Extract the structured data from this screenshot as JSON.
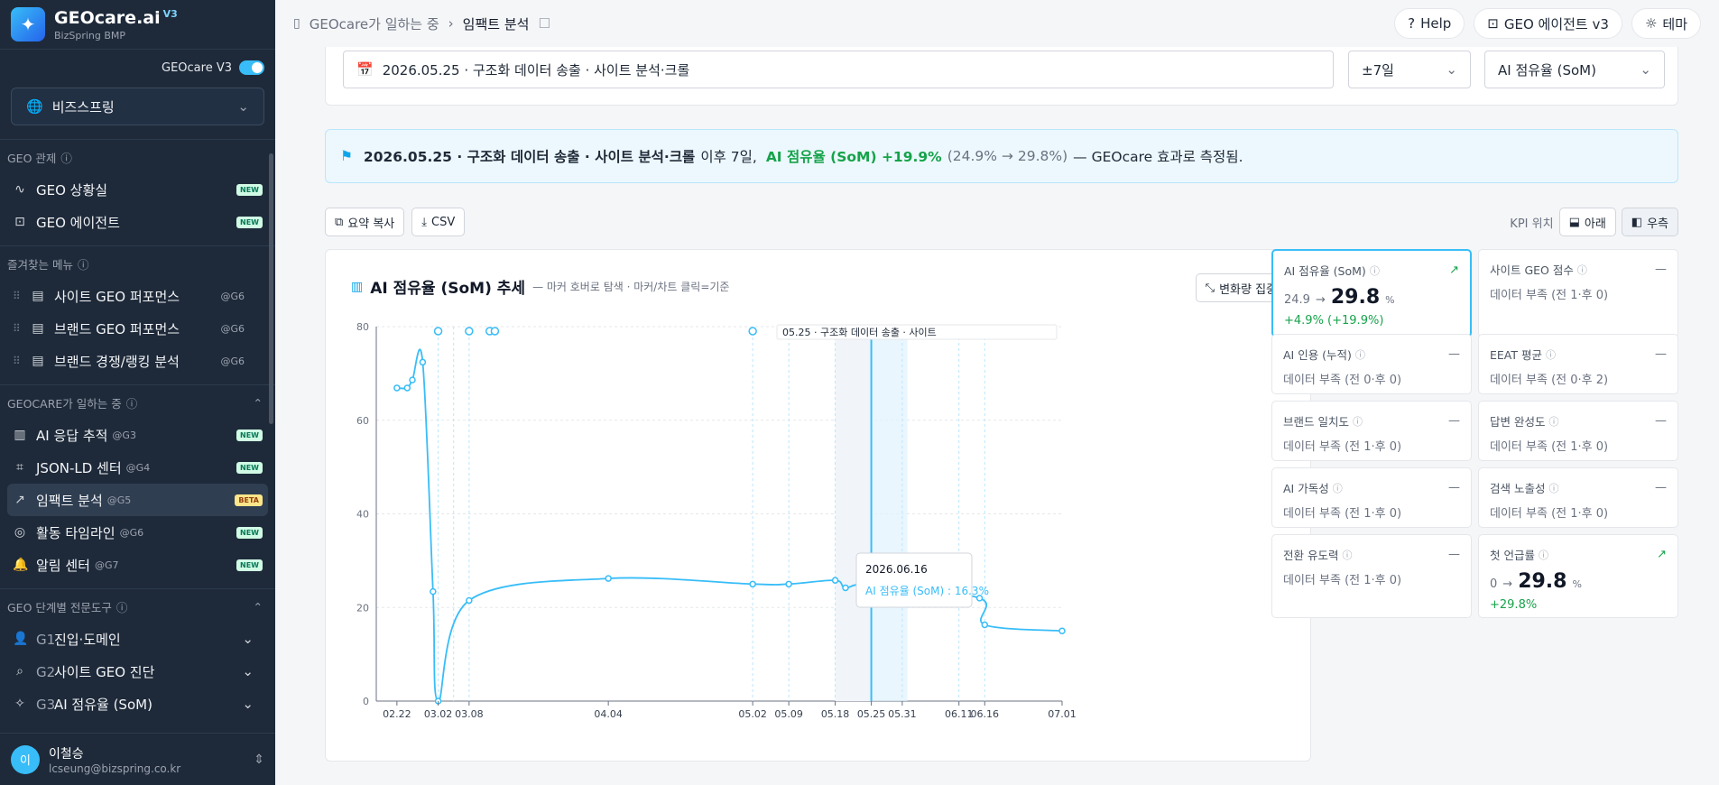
{
  "sidebar": {
    "brand": "GEOcare.ai",
    "version": "V3",
    "subtitle": "BizSpring BMP",
    "toggle_label": "GEOcare V3",
    "org": "비즈스프링",
    "sections": [
      {
        "title": "GEO 관제",
        "items": [
          {
            "icon": "pulse-icon",
            "label": "GEO 상황실",
            "badge": "NEW"
          },
          {
            "icon": "robot-icon",
            "label": "GEO 에이전트",
            "badge": "NEW"
          }
        ]
      },
      {
        "title": "즐겨찾는 메뉴",
        "items": [
          {
            "icon": "doc-icon",
            "label": "사이트 GEO 퍼포먼스",
            "tag": "@G6"
          },
          {
            "icon": "doc-icon",
            "label": "브랜드 GEO 퍼포먼스",
            "tag": "@G6"
          },
          {
            "icon": "doc-icon",
            "label": "브랜드 경쟁/랭킹 분석",
            "tag": "@G6"
          }
        ]
      },
      {
        "title": "GEOCARE가 일하는 중",
        "items": [
          {
            "icon": "chart-icon",
            "label": "AI 응답 추적",
            "tag": "@G3",
            "badge": "NEW"
          },
          {
            "icon": "code-icon",
            "label": "JSON-LD 센터",
            "tag": "@G4",
            "badge": "NEW"
          },
          {
            "icon": "trend-icon",
            "label": "임팩트 분석",
            "tag": "@G5",
            "badge": "BETA"
          },
          {
            "icon": "radio-icon",
            "label": "활동 타임라인",
            "tag": "@G6",
            "badge": "NEW"
          },
          {
            "icon": "bell-icon",
            "label": "알림 센터",
            "tag": "@G7",
            "badge": "NEW"
          }
        ]
      },
      {
        "title": "GEO 단계별 전문도구",
        "items": [
          {
            "icon": "user-plus-icon",
            "prefix": "G1",
            "label": "진입·도메인"
          },
          {
            "icon": "search-icon",
            "prefix": "G2",
            "label": "사이트 GEO 진단"
          },
          {
            "icon": "sparkle-icon",
            "prefix": "G3",
            "label": "AI 점유율 (SoM)"
          }
        ]
      }
    ],
    "user": {
      "initial": "이",
      "name": "이철승",
      "email": "lcseung@bizspring.co.kr"
    }
  },
  "topbar": {
    "crumbs": [
      "GEOcare가 일하는 중",
      "임팩트 분석"
    ],
    "help": "Help",
    "agent": "GEO 에이전트 v3",
    "theme": "테마"
  },
  "filters": {
    "event": "2026.05.25 · 구조화 데이터 송출 · 사이트 분석·크롤",
    "window": "±7일",
    "metric": "AI 점유율 (SoM)"
  },
  "banner": {
    "event": "2026.05.25 · 구조화 데이터 송출 · 사이트 분석·크롤",
    "after": "이후 7일,",
    "metric_change": "AI 점유율 (SoM) +19.9%",
    "range": "(24.9% → 29.8%)",
    "tail": "— GEOcare 효과로 측정됨."
  },
  "toolbar": {
    "copy": "요약 복사",
    "csv": "CSV",
    "kpi_pos_label": "KPI 위치",
    "below": "아래",
    "right": "우측"
  },
  "chart": {
    "title": "AI 점유율 (SoM) 추세",
    "subtitle": "— 마커 호버로 탐색 · 마커/차트 클릭=기준",
    "focus_btn": "변화량 집중",
    "marker_label": "05.25 · 구조화 데이터 송출 · 사이트",
    "tooltip_date": "2026.06.16",
    "tooltip_value": "AI 점유율 (SoM) : 16.3%"
  },
  "chart_data": {
    "type": "line",
    "title": "AI 점유율 (SoM) 추세",
    "ylim": [
      0,
      80
    ],
    "yticks": [
      0,
      20,
      40,
      60,
      80
    ],
    "xticks": [
      "02.22",
      "03.02",
      "03.08",
      "04.04",
      "05.02",
      "05.09",
      "05.18",
      "05.25",
      "05.31",
      "06.11",
      "06.16",
      "07.01"
    ],
    "grid": true,
    "series": [
      {
        "name": "AI 점유율 (SoM)",
        "color": "#38bdf8",
        "points": [
          {
            "x": "2026-02-22",
            "y": 66.9
          },
          {
            "x": "2026-02-24",
            "y": 66.9
          },
          {
            "x": "2026-02-25",
            "y": 68.6
          },
          {
            "x": "2026-02-27",
            "y": 72.4
          },
          {
            "x": "2026-03-01",
            "y": 23.4
          },
          {
            "x": "2026-03-02",
            "y": 0.0
          },
          {
            "x": "2026-03-08",
            "y": 21.5
          },
          {
            "x": "2026-04-04",
            "y": 26.2
          },
          {
            "x": "2026-05-02",
            "y": 25.0
          },
          {
            "x": "2026-05-09",
            "y": 25.0
          },
          {
            "x": "2026-05-18",
            "y": 25.8
          },
          {
            "x": "2026-05-20",
            "y": 24.2
          },
          {
            "x": "2026-05-25",
            "y": 24.9
          },
          {
            "x": "2026-06-15",
            "y": 22.0
          },
          {
            "x": "2026-06-16",
            "y": 16.3
          },
          {
            "x": "2026-07-01",
            "y": 15.0
          }
        ]
      }
    ],
    "event_markers": [
      "2026-03-02",
      "2026-03-05",
      "2026-03-08",
      "2026-05-02",
      "2026-05-09",
      "2026-05-18",
      "2026-05-25",
      "2026-05-31",
      "2026-06-11",
      "2026-06-16"
    ],
    "selected_event": "2026-05-25",
    "window_days": 7
  },
  "kpis": [
    {
      "title": "AI 점유율 (SoM)",
      "from": "24.9",
      "value": "29.8",
      "unit": "%",
      "change": "+4.9% (+19.9%)",
      "trend": "up",
      "selected": true
    },
    {
      "title": "사이트 GEO 점수",
      "desc": "데이터 부족 (전 1·후 0)",
      "trend": "flat"
    },
    {
      "title": "AI 인용 (누적)",
      "desc": "데이터 부족 (전 0·후 0)",
      "trend": "flat"
    },
    {
      "title": "EEAT 평균",
      "desc": "데이터 부족 (전 0·후 2)",
      "trend": "flat"
    },
    {
      "title": "브랜드 일치도",
      "desc": "데이터 부족 (전 1·후 0)",
      "trend": "flat"
    },
    {
      "title": "답변 완성도",
      "desc": "데이터 부족 (전 1·후 0)",
      "trend": "flat"
    },
    {
      "title": "AI 가독성",
      "desc": "데이터 부족 (전 1·후 0)",
      "trend": "flat"
    },
    {
      "title": "검색 노출성",
      "desc": "데이터 부족 (전 1·후 0)",
      "trend": "flat"
    },
    {
      "title": "전환 유도력",
      "desc": "데이터 부족 (전 1·후 0)",
      "trend": "flat"
    },
    {
      "title": "첫 언급률",
      "from": "0",
      "value": "29.8",
      "unit": "%",
      "change": "+29.8%",
      "trend": "up"
    }
  ]
}
